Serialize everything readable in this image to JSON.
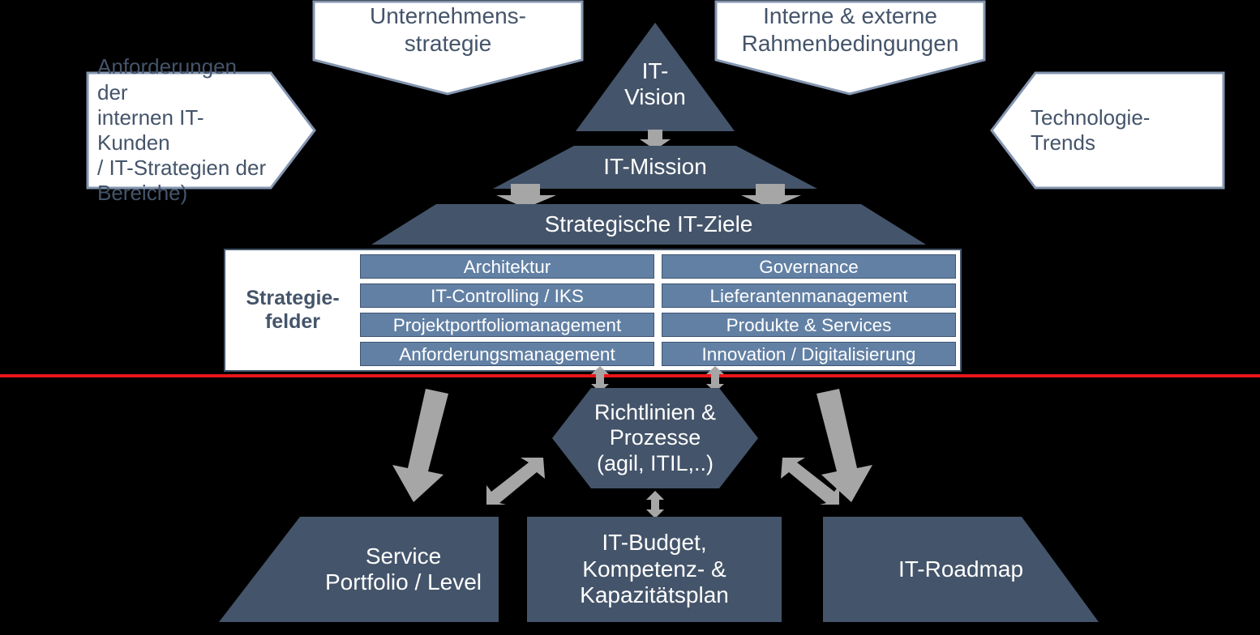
{
  "colors": {
    "dark_blue": "#44546a",
    "bar_blue": "#6280a4",
    "callout_border": "#8496b0",
    "callout_text": "#44546a",
    "arrow_gray": "#a6a6a6",
    "divider_red": "#e8161a",
    "background": "#000000",
    "white": "#ffffff"
  },
  "callouts": {
    "top_left": {
      "text": "Unternehmens-\nstrategie",
      "shape": "chevron-down"
    },
    "top_right": {
      "text": "Interne & externe\nRahmenbedingungen",
      "shape": "chevron-down"
    },
    "left": {
      "text": "Anforderungen der\ninternen IT-Kunden\n/ IT-Strategien der\nBereiche)",
      "shape": "arrow-right"
    },
    "right": {
      "text": "Technologie-\nTrends",
      "shape": "arrow-left"
    }
  },
  "pyramid": {
    "vision": {
      "text": "IT-\nVision",
      "shape": "triangle"
    },
    "mission": {
      "text": "IT-Mission",
      "shape": "trapezoid"
    },
    "goals": {
      "text": "Strategische IT-Ziele",
      "shape": "trapezoid"
    }
  },
  "strategy_fields": {
    "label": "Strategie-\nfelder",
    "left_column": [
      "Architektur",
      "IT-Controlling / IKS",
      "Projektportfoliomanagement",
      "Anforderungsmanagement"
    ],
    "right_column": [
      "Governance",
      "Lieferantenmanagement",
      "Produkte & Services",
      "Innovation / Digitalisierung"
    ]
  },
  "center_hexagon": {
    "text": "Richtlinien &\nProzesse\n(agil, ITIL,..)",
    "shape": "hexagon"
  },
  "bottom": {
    "left": {
      "text": "Service\nPortfolio / Level",
      "shape": "parallelogram-left"
    },
    "center": {
      "text": "IT-Budget,\nKompetenz- &\nKapazitätsplan",
      "shape": "rectangle"
    },
    "right": {
      "text": "IT-Roadmap",
      "shape": "parallelogram-right"
    }
  },
  "divider": {
    "label": "red-separator-line"
  }
}
